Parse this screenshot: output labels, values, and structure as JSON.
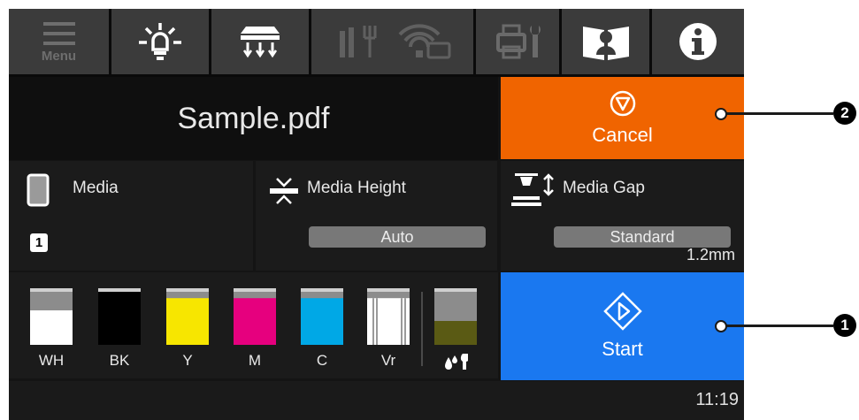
{
  "toolbar": {
    "menu_label": "Menu",
    "icons": [
      "menu-icon",
      "light-bulb-icon",
      "heater-icon",
      "network-icon",
      "maintenance-icon",
      "manual-icon",
      "info-icon"
    ]
  },
  "job": {
    "file_name": "Sample.pdf"
  },
  "cancel": {
    "label": "Cancel",
    "color": "#f06400"
  },
  "media": {
    "label": "Media",
    "number": "1"
  },
  "media_height": {
    "label": "Media Height",
    "value": "Auto"
  },
  "media_gap": {
    "label": "Media Gap",
    "value": "Standard",
    "gap": "1.2mm"
  },
  "inks": [
    {
      "label": "WH",
      "color": "#ffffff",
      "level": 0.65
    },
    {
      "label": "BK",
      "color": "#000000",
      "level": 1.0
    },
    {
      "label": "Y",
      "color": "#f7e600",
      "level": 0.88
    },
    {
      "label": "M",
      "color": "#e6007e",
      "level": 0.88
    },
    {
      "label": "C",
      "color": "#00a8e6",
      "level": 0.88
    },
    {
      "label": "Vr",
      "color": "#ffffff",
      "level": 0.88
    }
  ],
  "waste_ink": {
    "color": "#5a5a14",
    "level": 0.45
  },
  "start": {
    "label": "Start",
    "color": "#1a78f0"
  },
  "status": {
    "time": "11:19"
  },
  "callouts": [
    "2",
    "1"
  ]
}
